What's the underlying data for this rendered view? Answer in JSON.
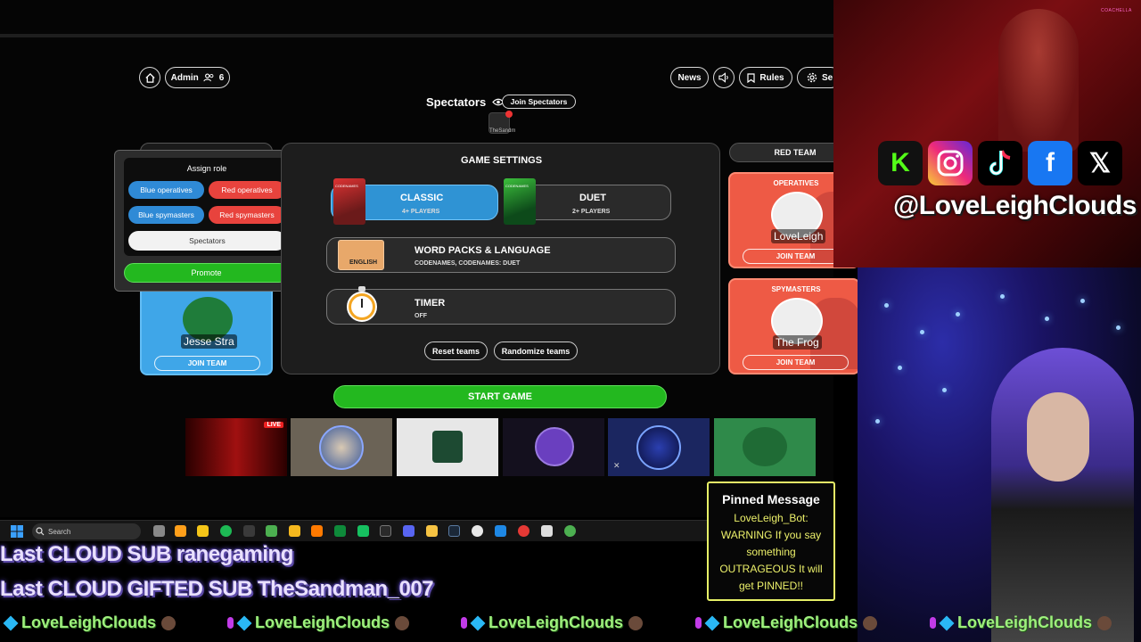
{
  "game": {
    "header": {
      "admin_label": "Admin",
      "player_count": "6",
      "news_label": "News",
      "rules_label": "Rules",
      "settings_label": "Se"
    },
    "spectators": {
      "title": "Spectators",
      "join_label": "Join Spectators",
      "member_name": "TheSandm"
    },
    "assign_role": {
      "title": "Assign role",
      "blue_operatives": "Blue operatives",
      "red_operatives": "Red operatives",
      "blue_spymasters": "Blue spymasters",
      "red_spymasters": "Red spymasters",
      "spectators": "Spectators",
      "promote": "Promote"
    },
    "blue_team": {
      "player_name": "Jesse Stra",
      "join_label": "JOIN TEAM"
    },
    "settings": {
      "title": "GAME SETTINGS",
      "classic_title": "CLASSIC",
      "classic_players": "4+ PLAYERS",
      "duet_title": "DUET",
      "duet_players": "2+ PLAYERS",
      "packs_title": "WORD PACKS & LANGUAGE",
      "packs_value": "CODENAMES, CODENAMES: DUET",
      "packs_box_label": "ENGLISH",
      "timer_title": "TIMER",
      "timer_value": "OFF",
      "reset_label": "Reset teams",
      "randomize_label": "Randomize teams",
      "box_text": "CODENAMES"
    },
    "red_team": {
      "title": "RED TEAM",
      "operatives_label": "OPERATIVES",
      "operative_name": "LoveLeigh",
      "spymasters_label": "SPYMASTERS",
      "spymaster_name": "The Frog",
      "join_label": "JOIN TEAM"
    },
    "start_label": "START GAME",
    "live_badge": "LIVE"
  },
  "taskbar": {
    "search_label": "Search"
  },
  "stream": {
    "coachella": "COACHELLA",
    "handle": "@LoveLeighClouds",
    "social_icons": [
      "kick-icon",
      "instagram-icon",
      "tiktok-icon",
      "facebook-icon",
      "x-icon"
    ],
    "pinned": {
      "title": "Pinned Message",
      "body": "LoveLeigh_Bot: WARNING If you say something OUTRAGEOUS It will get PINNED!!"
    },
    "last_sub": "Last CLOUD SUB ranegaming",
    "last_gifted": "Last CLOUD GIFTED SUB TheSandman_007",
    "ticker_name": "LoveLeighClouds"
  },
  "colors": {
    "blue_team": "#3fa6e8",
    "red_team": "#ee5a45",
    "green": "#23b81f",
    "pinned_border": "#e6f067"
  }
}
